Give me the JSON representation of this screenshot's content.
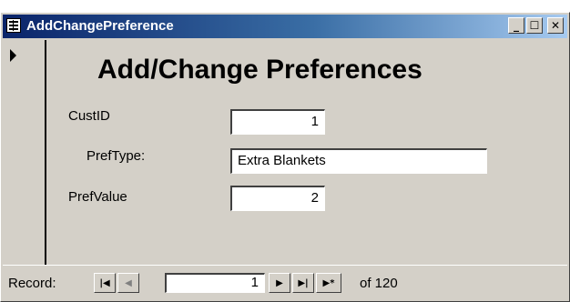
{
  "window": {
    "title": "AddChangePreference",
    "minimize_glyph": "_",
    "maximize_glyph": "☐",
    "close_glyph": "✕"
  },
  "form": {
    "heading": "Add/Change Preferences",
    "fields": {
      "custid_label": "CustID",
      "custid_value": "1",
      "preftype_label": "PrefType:",
      "preftype_value": "Extra Blankets",
      "prefvalue_label": "PrefValue",
      "prefvalue_value": "2"
    }
  },
  "navigation": {
    "record_label": "Record:",
    "first_glyph": "|◀",
    "prev_glyph": "◀",
    "current_record": "1",
    "next_glyph": "▶",
    "last_glyph": "▶|",
    "new_glyph": "▶*",
    "of_text": "of  120"
  },
  "icons": {
    "window_icon": "form-icon",
    "record_selector": "record-pointer-icon"
  }
}
